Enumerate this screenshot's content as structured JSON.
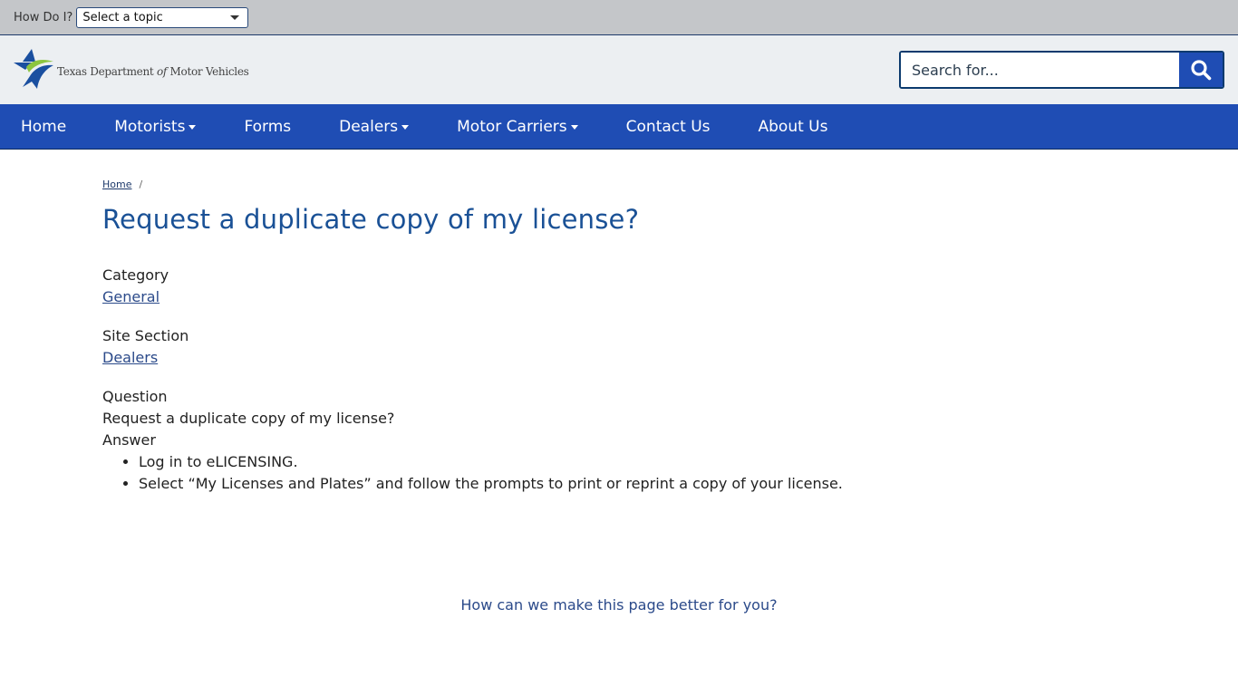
{
  "topbar": {
    "how_do_i_label": "How Do I?",
    "topic_select_value": "Select a topic"
  },
  "header": {
    "logo_text_part1": "Texas Department ",
    "logo_text_of": "of",
    "logo_text_part2": " Motor Vehicles",
    "search_placeholder": "Search for...",
    "search_icon": "search-icon"
  },
  "nav": {
    "items": [
      {
        "label": "Home",
        "dropdown": false
      },
      {
        "label": "Motorists",
        "dropdown": true
      },
      {
        "label": "Forms",
        "dropdown": false
      },
      {
        "label": "Dealers",
        "dropdown": true
      },
      {
        "label": "Motor Carriers",
        "dropdown": true
      },
      {
        "label": "Contact Us",
        "dropdown": false
      },
      {
        "label": "About Us",
        "dropdown": false
      }
    ]
  },
  "breadcrumb": {
    "home": "Home",
    "separator": "/"
  },
  "page": {
    "title": "Request a duplicate copy of my license?",
    "category_label": "Category",
    "category_value": "General",
    "site_section_label": "Site Section",
    "site_section_value": "Dealers",
    "question_label": "Question",
    "question_value": "Request a duplicate copy of my license?",
    "answer_label": "Answer",
    "answers": [
      "Log in to eLICENSING.",
      "Select “My Licenses and Plates” and follow the prompts to print or reprint a copy of your license."
    ]
  },
  "feedback": {
    "link_text": "How can we make this page better for you?"
  },
  "colors": {
    "nav_bg": "#1f4db4",
    "title": "#1a5196",
    "link": "#2b4a8a",
    "topbar_bg": "#c4c6c9",
    "header_bg": "#eceff2"
  }
}
